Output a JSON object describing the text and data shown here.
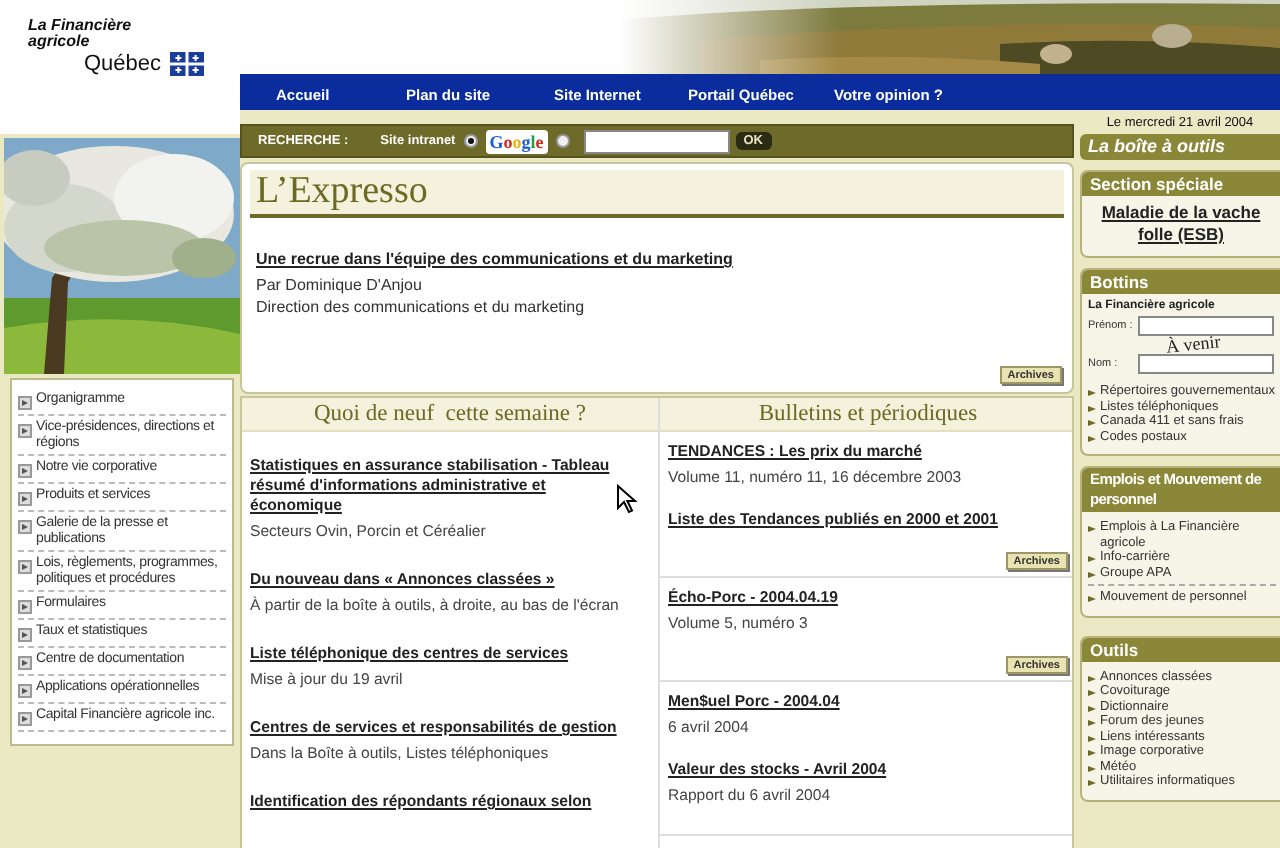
{
  "logo": {
    "lines": [
      "La Financière",
      "agricole"
    ],
    "name": "Québec"
  },
  "nav": [
    {
      "label": "Accueil"
    },
    {
      "label": "Plan du site"
    },
    {
      "label": "Site Internet"
    },
    {
      "label": "Portail Québec"
    },
    {
      "label": "Votre opinion ?"
    }
  ],
  "sidebar_menu": [
    {
      "label": "Organigramme"
    },
    {
      "label": "Vice-présidences, directions et régions"
    },
    {
      "label": "Notre vie corporative"
    },
    {
      "label": "Produits et services"
    },
    {
      "label": "Galerie de la presse et publications"
    },
    {
      "label": "Lois, règlements, programmes, politiques et procédures"
    },
    {
      "label": "Formulaires"
    },
    {
      "label": "Taux et statistiques"
    },
    {
      "label": "Centre de documentation"
    },
    {
      "label": "Applications opérationnelles"
    },
    {
      "label": "Capital Financière agricole inc."
    }
  ],
  "search": {
    "label": "RECHERCHE :",
    "options": [
      {
        "label": "Site intranet",
        "kind": "text",
        "selected": true
      },
      {
        "label": "Google",
        "kind": "logo",
        "selected": false
      }
    ],
    "button": "OK"
  },
  "expresso": {
    "title": "L’Expresso",
    "article": {
      "title": "Une recrue dans l'équipe des communications et du marketing",
      "lines": [
        "Par Dominique D'Anjou",
        "Direction des communications et du marketing"
      ]
    },
    "archives": "Archives"
  },
  "whats_new": {
    "title": "Quoi de neuf  cette semaine ?",
    "items": [
      {
        "title": "Statistiques en assurance stabilisation - Tableau résumé d'informations administrative et économique",
        "subtitle": "Secteurs Ovin, Porcin et Céréalier"
      },
      {
        "title": "Du nouveau dans « Annonces classées »",
        "subtitle": "À partir de la boîte à outils, à droite, au bas de l'écran"
      },
      {
        "title": "Liste téléphonique des centres de services",
        "subtitle": "Mise à jour du 19 avril"
      },
      {
        "title": "Centres de services et responsabilités de gestion",
        "subtitle": "Dans la Boîte à outils, Listes téléphoniques"
      },
      {
        "title": "Identification des répondants régionaux selon"
      }
    ]
  },
  "bulletins": {
    "title": "Bulletins et périodiques",
    "groups": [
      {
        "items": [
          {
            "title": "TENDANCES : Les prix du marché",
            "subtitle": "Volume 11, numéro 11, 16 décembre 2003"
          },
          {
            "title": "Liste des Tendances publiés en 2000 et 2001"
          }
        ],
        "archives": "Archives"
      },
      {
        "items": [
          {
            "title": "Écho-Porc - 2004.04.19",
            "subtitle": "Volume 5, numéro 3"
          }
        ],
        "archives": "Archives"
      },
      {
        "items": [
          {
            "title": "Men$uel Porc - 2004.04",
            "subtitle": "6 avril 2004"
          },
          {
            "title": "Valeur des stocks - Avril 2004",
            "subtitle": "Rapport du 6 avril 2004"
          }
        ]
      }
    ]
  },
  "toolbox": {
    "date": "Le mercredi 21 avril 2004",
    "title": "La boîte à outils",
    "special": {
      "title": "Section spéciale",
      "link": "Maladie de la vache folle (ESB)"
    },
    "directories": {
      "title": "Bottins",
      "subtitle": "La Financière agricole",
      "fields": [
        {
          "label": "Prénom :"
        },
        {
          "label": "Nom :"
        }
      ],
      "stamp": "À venir",
      "links": [
        "Répertoires gouvernementaux",
        "Listes téléphoniques",
        "Canada 411 et sans frais",
        "Codes postaux"
      ]
    },
    "jobs": {
      "title": "Emplois et Mouvement de personnel",
      "links": [
        {
          "label": "Emplois à La Financière agricole",
          "divider": false
        },
        {
          "label": "Info-carrière",
          "divider": false
        },
        {
          "label": "Groupe APA",
          "divider": false
        },
        {
          "label": "Mouvement de personnel",
          "divider": true
        }
      ]
    },
    "tools": {
      "title": "Outils",
      "links": [
        "Annonces classées",
        "Covoiturage",
        "Dictionnaire",
        "Forum des jeunes",
        "Liens intéressants",
        "Image corporative",
        "Météo",
        "Utilitaires informatiques"
      ]
    }
  }
}
